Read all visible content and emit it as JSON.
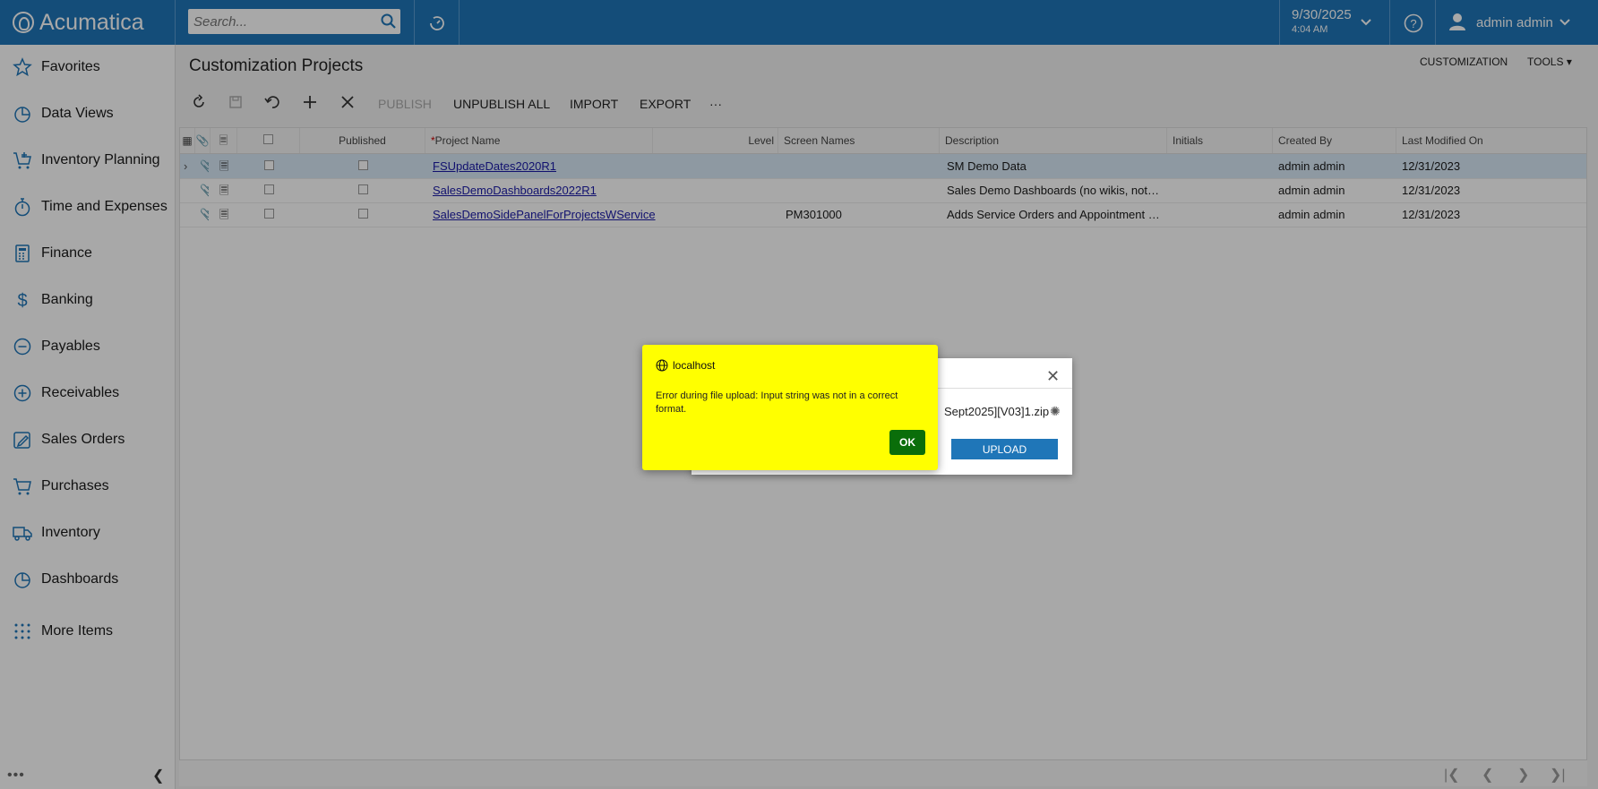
{
  "app": {
    "name": "Acumatica"
  },
  "search": {
    "placeholder": "Search..."
  },
  "header": {
    "date": "9/30/2025",
    "time": "4:04 AM",
    "user": "admin admin"
  },
  "sidebar": {
    "items": [
      {
        "label": "Favorites",
        "icon": "star-icon"
      },
      {
        "label": "Data Views",
        "icon": "pie-chart-icon"
      },
      {
        "label": "Inventory Planning",
        "icon": "cart-plus-icon"
      },
      {
        "label": "Time and Expenses",
        "icon": "stopwatch-icon"
      },
      {
        "label": "Finance",
        "icon": "calculator-icon"
      },
      {
        "label": "Banking",
        "icon": "dollar-icon"
      },
      {
        "label": "Payables",
        "icon": "minus-circle-icon"
      },
      {
        "label": "Receivables",
        "icon": "plus-circle-icon"
      },
      {
        "label": "Sales Orders",
        "icon": "pencil-icon"
      },
      {
        "label": "Purchases",
        "icon": "cart-icon"
      },
      {
        "label": "Inventory",
        "icon": "truck-icon"
      },
      {
        "label": "Dashboards",
        "icon": "pie-chart-icon"
      },
      {
        "label": "More Items",
        "icon": "grid-dots-icon"
      }
    ],
    "footer_dots": "•••"
  },
  "page": {
    "title": "Customization Projects",
    "top_links": {
      "customization": "CUSTOMIZATION",
      "tools": "TOOLS"
    }
  },
  "toolbar": {
    "publish": "PUBLISH",
    "unpublish_all": "UNPUBLISH ALL",
    "import": "IMPORT",
    "export": "EXPORT",
    "more": "···"
  },
  "grid": {
    "columns": {
      "published": "Published",
      "project_name": "Project Name",
      "required_mark": "*",
      "level": "Level",
      "screen_names": "Screen Names",
      "description": "Description",
      "initials": "Initials",
      "created_by": "Created By",
      "last_modified_on": "Last Modified On"
    },
    "rows": [
      {
        "project_name": "FSUpdateDates2020R1",
        "level": "",
        "screen_names": "",
        "description": "SM Demo Data",
        "initials": "",
        "created_by": "admin admin",
        "last_modified_on": "12/31/2023"
      },
      {
        "project_name": "SalesDemoDashboards2022R1",
        "level": "",
        "screen_names": "",
        "description": "Sales Demo Dashboards (no wikis, not i...",
        "initials": "",
        "created_by": "admin admin",
        "last_modified_on": "12/31/2023"
      },
      {
        "project_name": "SalesDemoSidePanelForProjectsWService",
        "level": "",
        "screen_names": "PM301000",
        "description": "Adds Service Orders and Appointment S...",
        "initials": "",
        "created_by": "admin admin",
        "last_modified_on": "12/31/2023"
      }
    ]
  },
  "upload_dialog": {
    "file_name": "Sept2025][V03]1.zip",
    "upload_label": "UPLOAD"
  },
  "alert": {
    "title": "localhost",
    "message": "Error during file upload: Input string was not in a correct format.",
    "ok_label": "OK"
  },
  "colors": {
    "brand": "#1f76b8",
    "alert_bg": "#ffff00",
    "ok_button": "#0a6e0a"
  }
}
